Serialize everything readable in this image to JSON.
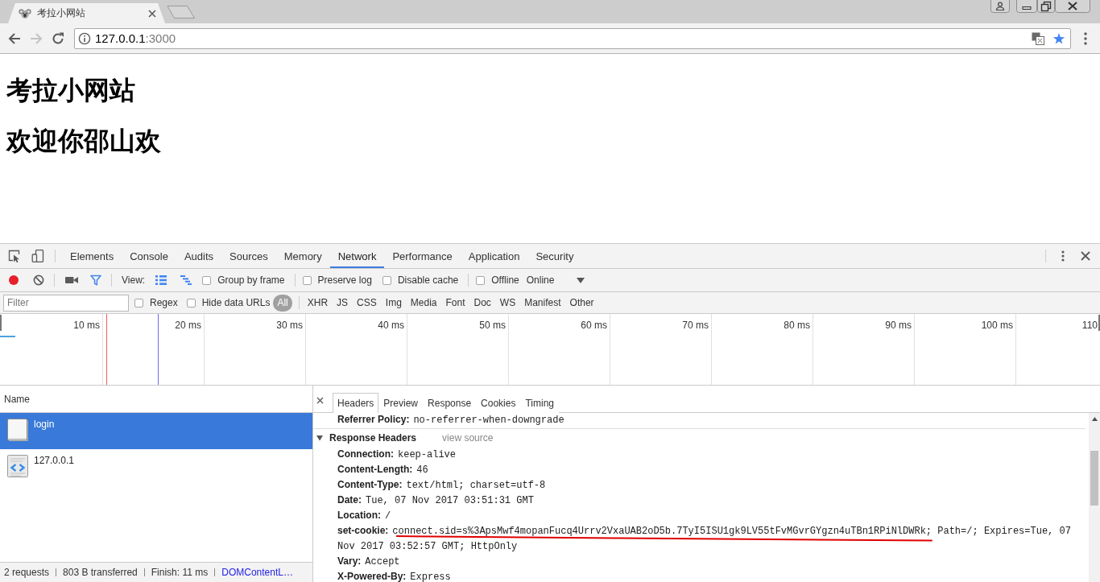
{
  "browser": {
    "tabs": [
      {
        "title": "考拉小网站",
        "selected": true
      }
    ],
    "navigation": [
      {
        "kind": "back",
        "disabled": false
      },
      {
        "kind": "forward",
        "disabled": true
      },
      {
        "kind": "reload",
        "disabled": false
      }
    ],
    "address": {
      "host": "127.0.0.1",
      "port": ":3000"
    },
    "bookmarked": true
  },
  "page": {
    "headings": [
      "考拉小网站",
      "欢迎你邵山欢"
    ]
  },
  "devtools": {
    "tabs": [
      {
        "label": "Elements",
        "selected": false
      },
      {
        "label": "Console",
        "selected": false
      },
      {
        "label": "Audits",
        "selected": false
      },
      {
        "label": "Sources",
        "selected": false
      },
      {
        "label": "Memory",
        "selected": false
      },
      {
        "label": "Network",
        "selected": true
      },
      {
        "label": "Performance",
        "selected": false
      },
      {
        "label": "Application",
        "selected": false
      },
      {
        "label": "Security",
        "selected": false
      }
    ],
    "toolbar": {
      "recording": true,
      "view_label": "View:",
      "view_toggles": [
        {
          "kind": "large-rows",
          "on": true
        },
        {
          "kind": "overview",
          "on": true
        }
      ],
      "options": [
        {
          "label": "Group by frame",
          "checked": false
        },
        {
          "label": "Preserve log",
          "checked": false
        },
        {
          "label": "Disable cache",
          "checked": false
        },
        {
          "label": "Offline",
          "checked": false
        }
      ],
      "throttling": "Online"
    },
    "filter_bar": {
      "placeholder": "Filter",
      "options": [
        {
          "label": "Regex",
          "checked": false
        },
        {
          "label": "Hide data URLs",
          "checked": false
        }
      ],
      "types": [
        {
          "label": "All",
          "selected": true
        },
        {
          "label": "XHR",
          "selected": false
        },
        {
          "label": "JS",
          "selected": false
        },
        {
          "label": "CSS",
          "selected": false
        },
        {
          "label": "Img",
          "selected": false
        },
        {
          "label": "Media",
          "selected": false
        },
        {
          "label": "Font",
          "selected": false
        },
        {
          "label": "Doc",
          "selected": false
        },
        {
          "label": "WS",
          "selected": false
        },
        {
          "label": "Manifest",
          "selected": false
        },
        {
          "label": "Other",
          "selected": false
        }
      ]
    },
    "overview": {
      "ticks": [
        "10 ms",
        "20 ms",
        "30 ms",
        "40 ms",
        "50 ms",
        "60 ms",
        "70 ms",
        "80 ms",
        "90 ms",
        "100 ms",
        "110"
      ]
    },
    "requests": {
      "column": "Name",
      "rows": [
        {
          "name": "login",
          "kind": "document",
          "selected": true
        },
        {
          "name": "127.0.0.1",
          "kind": "html",
          "selected": false
        }
      ]
    },
    "summary": [
      {
        "text": "2 requests",
        "kind": "plain"
      },
      {
        "text": "803 B transferred",
        "kind": "plain"
      },
      {
        "text": "Finish: 11 ms",
        "kind": "plain"
      },
      {
        "text": "DOMContentL…",
        "kind": "timing"
      }
    ],
    "detail": {
      "tabs": [
        {
          "label": "Headers",
          "selected": true
        },
        {
          "label": "Preview",
          "selected": false
        },
        {
          "label": "Response",
          "selected": false
        },
        {
          "label": "Cookies",
          "selected": false
        },
        {
          "label": "Timing",
          "selected": false
        }
      ],
      "general": [
        {
          "key": "Referrer Policy:",
          "value": "no-referrer-when-downgrade"
        }
      ],
      "sections": [
        {
          "title": "Response Headers",
          "expanded": true,
          "link": "view source",
          "headers": [
            {
              "key": "Connection:",
              "value": "keep-alive",
              "underlined": false
            },
            {
              "key": "Content-Length:",
              "value": "46",
              "underlined": false
            },
            {
              "key": "Content-Type:",
              "value": "text/html; charset=utf-8",
              "underlined": false
            },
            {
              "key": "Date:",
              "value": "Tue, 07 Nov 2017 03:51:31 GMT",
              "underlined": false
            },
            {
              "key": "Location:",
              "value": "/",
              "underlined": false
            },
            {
              "key": "set-cookie:",
              "value": "connect.sid=s%3ApsMwf4mopanFucq4Urrv2VxaUAB2oD5b.7TyI5ISU1gk9LV55tFvMGvrGYgzn4uTBn1RPiNlDWRk; Path=/; Expires=Tue, 07 Nov 2017 03:52:57 GMT; HttpOnly",
              "underlined": true
            },
            {
              "key": "Vary:",
              "value": "Accept",
              "underlined": false
            },
            {
              "key": "X-Powered-By:",
              "value": "Express",
              "underlined": false
            }
          ]
        }
      ]
    }
  }
}
